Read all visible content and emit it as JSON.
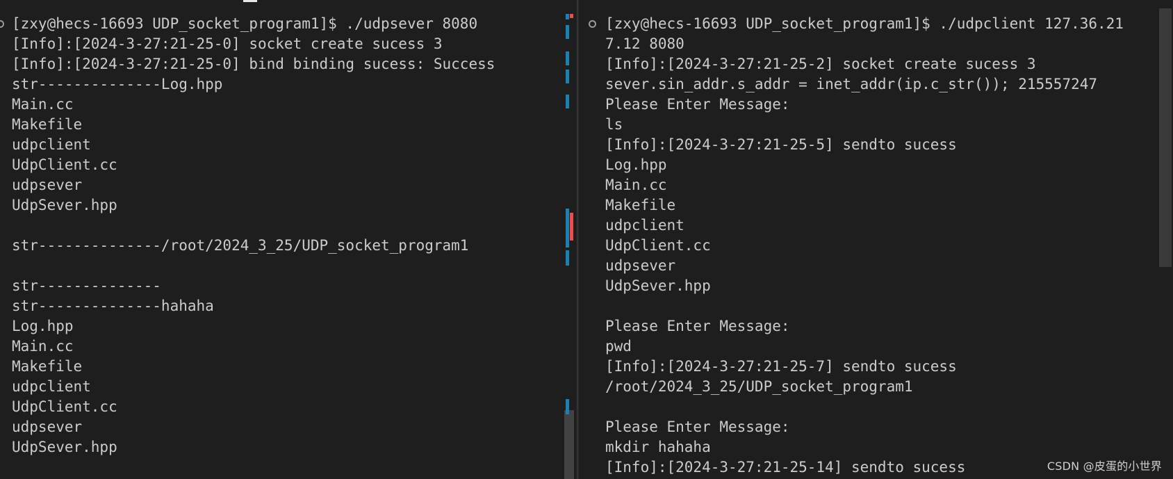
{
  "left_terminal": {
    "lines": [
      "[zxy@hecs-16693 UDP_socket_program1]$ ./udpsever 8080",
      "[Info]:[2024-3-27:21-25-0] socket create sucess 3",
      "[Info]:[2024-3-27:21-25-0] bind binding sucess: Success",
      "str--------------Log.hpp",
      "Main.cc",
      "Makefile",
      "udpclient",
      "UdpClient.cc",
      "udpsever",
      "UdpSever.hpp",
      "",
      "str--------------/root/2024_3_25/UDP_socket_program1",
      "",
      "str--------------",
      "str--------------hahaha",
      "Log.hpp",
      "Main.cc",
      "Makefile",
      "udpclient",
      "UdpClient.cc",
      "udpsever",
      "UdpSever.hpp",
      ""
    ]
  },
  "right_terminal": {
    "lines": [
      "[zxy@hecs-16693 UDP_socket_program1]$ ./udpclient 127.36.21",
      "7.12 8080",
      "[Info]:[2024-3-27:21-25-2] socket create sucess 3",
      "sever.sin_addr.s_addr = inet_addr(ip.c_str()); 215557247",
      "Please Enter Message:",
      "ls",
      "[Info]:[2024-3-27:21-25-5] sendto sucess",
      "Log.hpp",
      "Main.cc",
      "Makefile",
      "udpclient",
      "UdpClient.cc",
      "udpsever",
      "UdpSever.hpp",
      "",
      "Please Enter Message:",
      "pwd",
      "[Info]:[2024-3-27:21-25-7] sendto sucess",
      "/root/2024_3_25/UDP_socket_program1",
      "",
      "Please Enter Message:",
      "mkdir hahaha",
      "[Info]:[2024-3-27:21-25-14] sendto sucess"
    ]
  },
  "watermark": "CSDN @皮蛋的小世界",
  "colors": {
    "background": "#1e1e1e",
    "text": "#cccccc",
    "decoration_blue": "#1b80b2",
    "decoration_red": "#f14c4c"
  },
  "icons": {
    "command_marker": "circle-outline-icon"
  }
}
